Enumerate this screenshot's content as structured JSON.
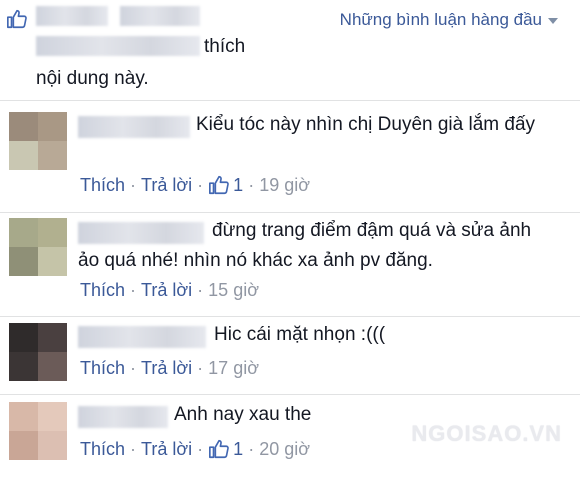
{
  "header": {
    "summary_suffix": "thích",
    "summary_line2": "nội dung này.",
    "sort_label": "Những bình luận hàng đầu"
  },
  "comments": [
    {
      "text": "Kiểu tóc này nhìn chị Duyên già lắm đấy",
      "like_label": "Thích",
      "reply_label": "Trả lời",
      "like_count": "1",
      "time": "19 giờ",
      "avatar_colors": [
        "#9b8b7b",
        "#a99885",
        "#c9c7b2",
        "#b8a996"
      ]
    },
    {
      "text": "đừng trang điểm đậm quá và sửa ảnh ảo quá nhé! nhìn nó khác xa ảnh pv đăng.",
      "like_label": "Thích",
      "reply_label": "Trả lời",
      "time": "15 giờ",
      "avatar_colors": [
        "#a7a98a",
        "#b1b08f",
        "#8f9077",
        "#c5c4a8"
      ]
    },
    {
      "text": "Hic cái mặt nhọn :(((",
      "like_label": "Thích",
      "reply_label": "Trả lời",
      "time": "17 giờ",
      "avatar_colors": [
        "#2f2b2b",
        "#4a4040",
        "#3b3535",
        "#6b5b58"
      ]
    },
    {
      "text": "Anh nay xau the",
      "like_label": "Thích",
      "reply_label": "Trả lời",
      "like_count": "1",
      "time": "20 giờ",
      "avatar_colors": [
        "#d8b8a8",
        "#e4c9bb",
        "#c9a696",
        "#dcbfb2"
      ]
    }
  ],
  "watermark": "NGOISAO.VN",
  "colors": {
    "link": "#3b5998",
    "meta": "#9197a3",
    "divider": "#e1e2e3"
  },
  "icons": [
    "like-icon",
    "chevron-down-icon"
  ]
}
